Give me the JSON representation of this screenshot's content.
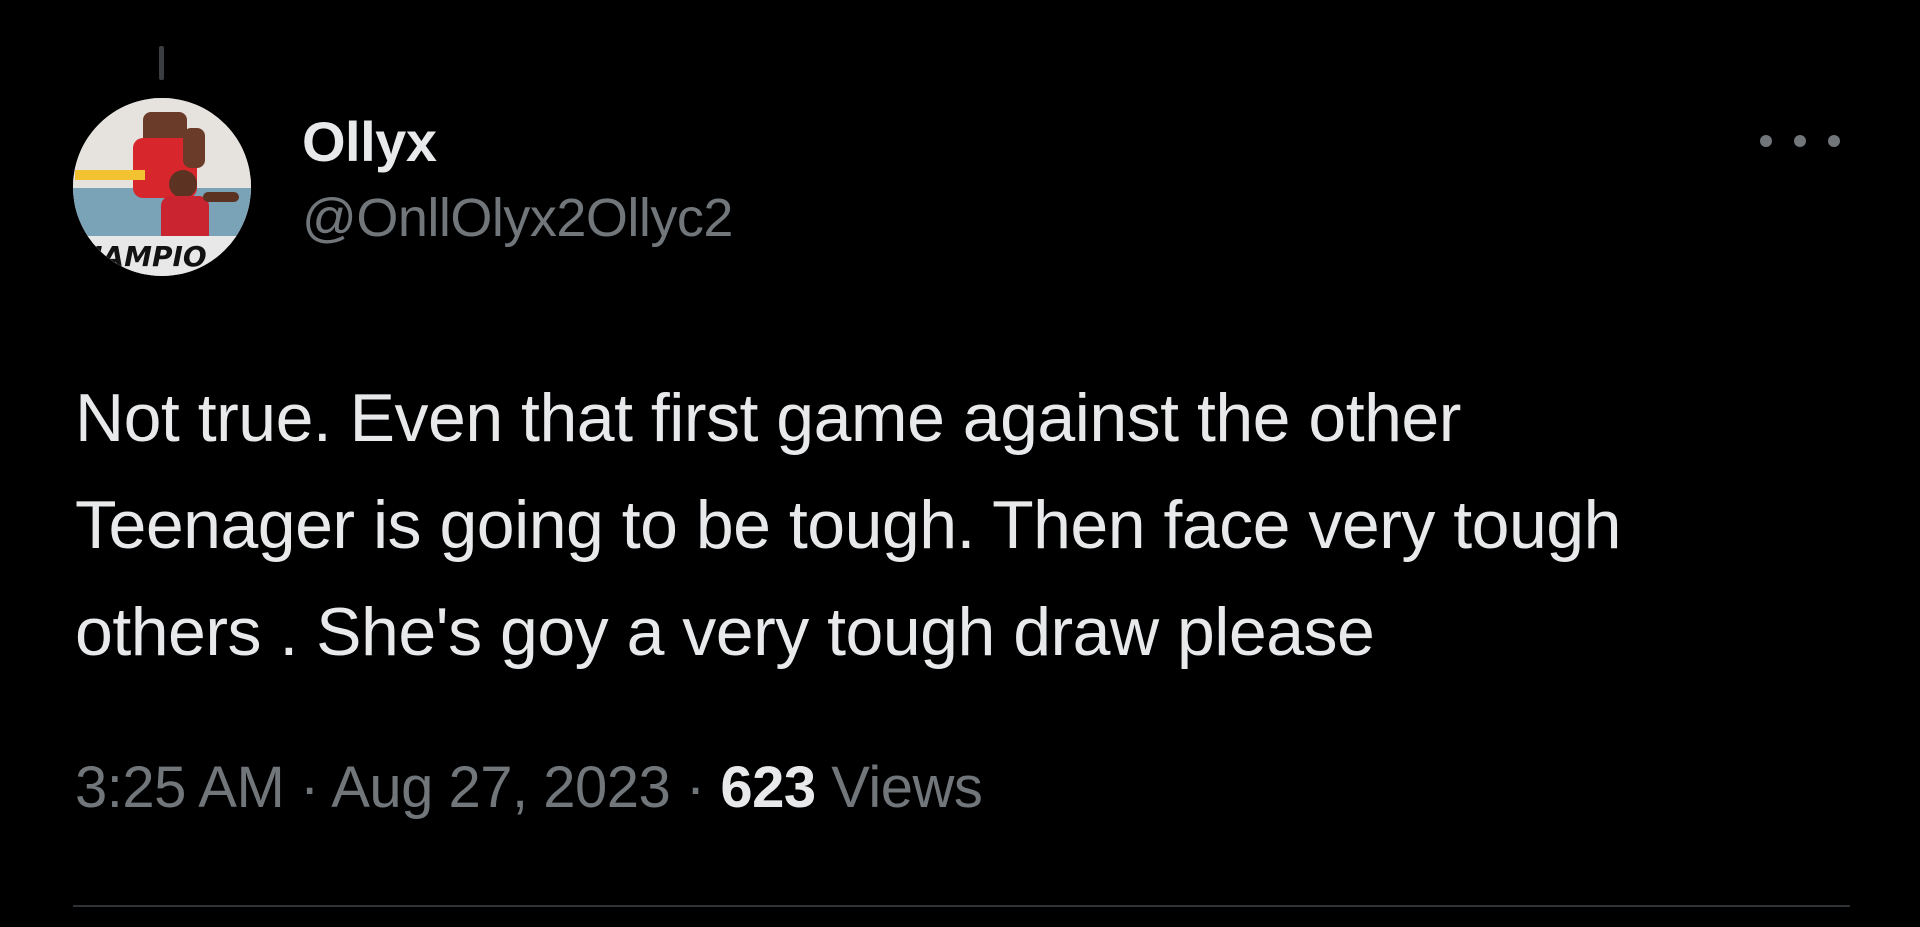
{
  "author": {
    "display_name": "Ollyx",
    "handle": "@OnllOlyx2Ollyc2",
    "avatar_banner_text": "HAMPIO"
  },
  "tweet": {
    "text": "Not true. Even that first game against the other\nTeenager is going to be tough. Then face very tough\nothers . She's goy a very tough draw please"
  },
  "meta": {
    "time": "3:25 AM",
    "separator": "·",
    "date": "Aug 27, 2023",
    "views_count": "623",
    "views_label": "Views"
  },
  "icons": {
    "more": "more-horizontal-icon"
  },
  "colors": {
    "background": "#000000",
    "primary_text": "#e7e9ea",
    "secondary_text": "#71767b",
    "divider": "#2f3336"
  }
}
